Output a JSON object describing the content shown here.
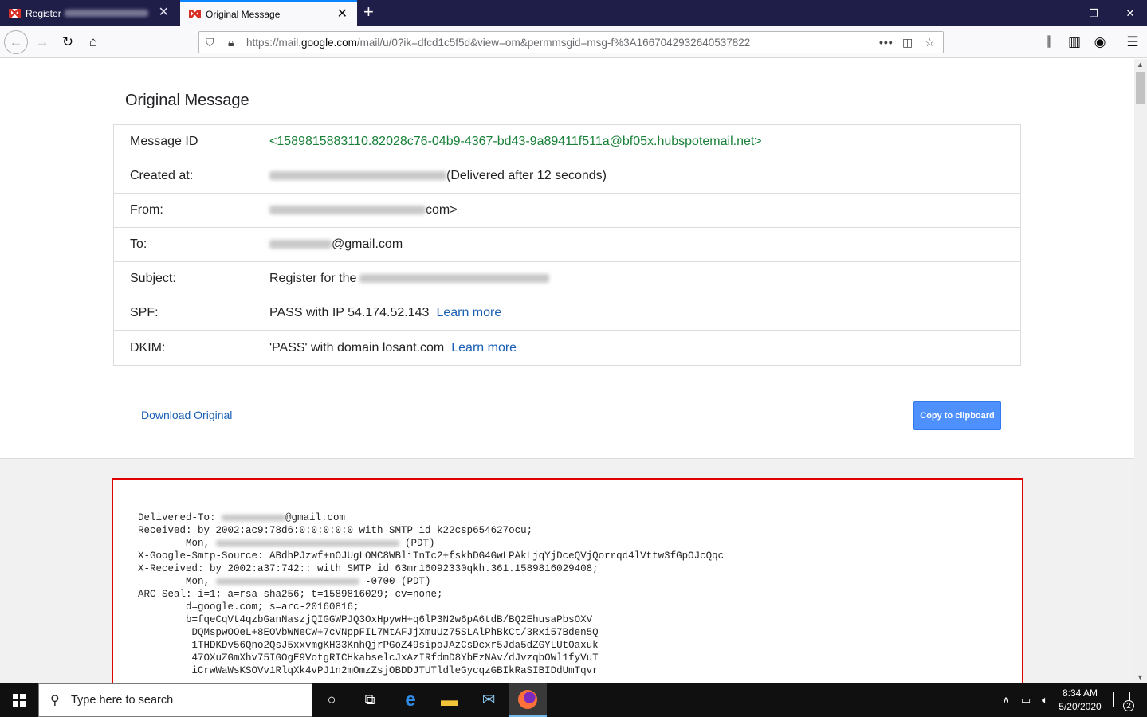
{
  "browser": {
    "tabs": [
      {
        "label": "Register"
      },
      {
        "label": "Original Message"
      }
    ],
    "url_prefix": "https://mail.",
    "url_domain": "google.com",
    "url_path": "/mail/u/0?ik=dfcd1c5f5d&view=om&permmsgid=msg-f%3A1667042932640537822"
  },
  "page": {
    "title": "Original Message",
    "rows": [
      {
        "key": "Message ID",
        "value": "<1589815883110.82028c76-04b9-4367-bd43-9a89411f511a@bf05x.hubspotemail.net>"
      },
      {
        "key": "Created at:",
        "value": "(Delivered after 12 seconds)"
      },
      {
        "key": "From:",
        "value": "com>"
      },
      {
        "key": "To:",
        "value": "@gmail.com"
      },
      {
        "key": "Subject:",
        "value": "Register for the"
      },
      {
        "key": "SPF:",
        "value": "PASS with IP 54.174.52.143",
        "link": "Learn more"
      },
      {
        "key": "DKIM:",
        "value": "'PASS' with domain losant.com",
        "link": "Learn more"
      }
    ],
    "download_label": "Download Original",
    "copy_label": "Copy to clipboard",
    "raw_lines": [
      "Delivered-To: ",
      "@gmail.com",
      "Received: by 2002:ac9:78d6:0:0:0:0:0 with SMTP id k22csp654627ocu;",
      "        Mon, ",
      " (PDT)",
      "X-Google-Smtp-Source: ABdhPJzwf+nOJUgLOMC8WBliTnTc2+fskhDG4GwLPAkLjqYjDceQVjQorrqd4lVttw3fGpOJcQqc",
      "X-Received: by 2002:a37:742:: with SMTP id 63mr16092330qkh.361.1589816029408;",
      " -0700 (PDT)",
      "ARC-Seal: i=1; a=rsa-sha256; t=1589816029; cv=none;",
      "        d=google.com; s=arc-20160816;",
      "        b=fqeCqVt4qzbGanNaszjQIGGWPJQ3OxHpywH+q6lP3N2w6pA6tdB/BQ2EhusaPbsOXV",
      "         DQMspwOOeL+8EOVbWNeCW+7cVNppFIL7MtAFJjXmuUz75SLAlPhBkCt/3Rxi57Bden5Q",
      "         1THDKDv56Qno2QsJ5xxvmgKH33KnhQjrPGoZ49sipoJAzCsDcxr5Jda5dZGYLUtOaxuk",
      "         47OXuZGmXhv75IGOgE9VotgRICHkabselcJxAzIRfdmD8YbEzNAv/dJvzqbOWl1fyVuT",
      "         iCrwWaWsKSOVv1RlqXk4vPJ1n2mOmzZsjOBDDJTUTldleGycqzGBIkRaSIBIDdUmTqvr"
    ]
  },
  "taskbar": {
    "search_placeholder": "Type here to search",
    "time": "8:34 AM",
    "date": "5/20/2020",
    "notif_count": "2"
  }
}
